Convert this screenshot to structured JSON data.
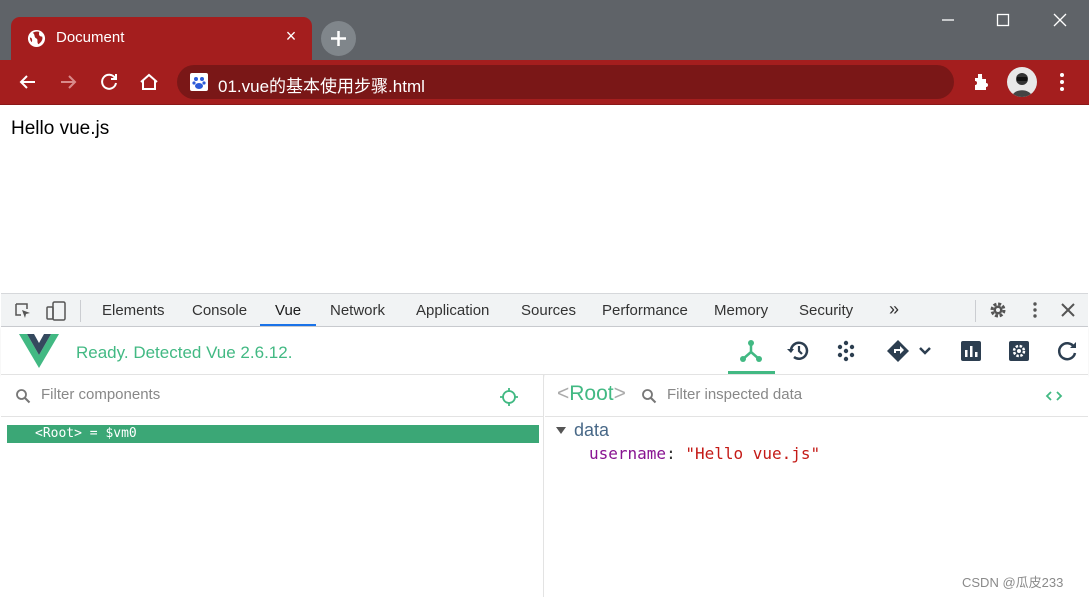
{
  "browser": {
    "tab_title": "Document",
    "url": "01.vue的基本使用步骤.html"
  },
  "page": {
    "text": "Hello vue.js"
  },
  "devtools": {
    "tabs": [
      "Elements",
      "Console",
      "Vue",
      "Network",
      "Application",
      "Sources",
      "Performance",
      "Memory",
      "Security"
    ],
    "more_label": "»",
    "active_tab": "Vue"
  },
  "vue": {
    "status": "Ready. Detected Vue 2.6.12.",
    "accent_color": "#42b983",
    "toolbar_icons": [
      "components-icon",
      "history-icon",
      "vuex-icon",
      "routing-icon",
      "performance-icon",
      "settings-icon",
      "refresh-icon"
    ]
  },
  "components": {
    "filter_placeholder": "Filter components",
    "root_row": "<Root> = $vm0"
  },
  "inspector": {
    "title": "Root",
    "filter_placeholder": "Filter inspected data",
    "section": "data",
    "props": [
      {
        "key": "username",
        "value": "\"Hello vue.js\""
      }
    ]
  },
  "watermark": "CSDN @瓜皮233"
}
